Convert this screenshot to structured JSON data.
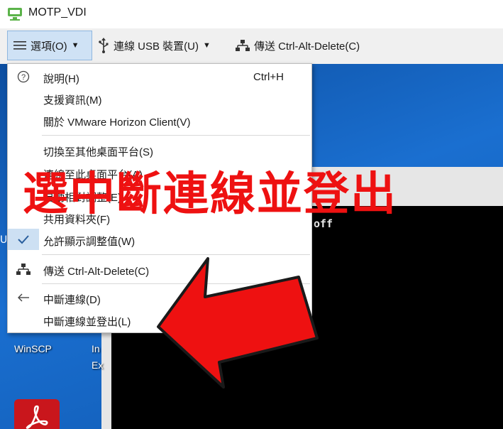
{
  "window": {
    "title": "MOTP_VDI",
    "app_icon": "vmware-horizon-icon"
  },
  "toolbar": {
    "options_label": "選項(O)",
    "usb_label": "連線 USB 裝置(U)",
    "send_cad_label": "傳送 Ctrl-Alt-Delete(C)"
  },
  "menu": {
    "items": [
      {
        "label": "說明(H)",
        "shortcut": "Ctrl+H",
        "icon": "help-icon"
      },
      {
        "label": "支援資訊(M)"
      },
      {
        "label": "關於 VMware Horizon Client(V)"
      },
      {
        "label": "切換至其他桌面平台(S)"
      },
      {
        "label": "連線至此桌面平台(A)"
      },
      {
        "label": "自動相對調整(E)"
      },
      {
        "label": "共用資料夾(F)"
      },
      {
        "label": "允許顯示調整值(W)",
        "checked": true,
        "icon": "check-icon"
      },
      {
        "label": "傳送 Ctrl-Alt-Delete(C)",
        "icon": "network-icon"
      },
      {
        "label": "中斷連線(D)",
        "icon": "back-arrow-icon"
      },
      {
        "label": "中斷連線並登出(L)"
      }
    ]
  },
  "desktop": {
    "icons": [
      {
        "label": "WinSCP"
      },
      {
        "label": "In"
      },
      {
        "label": "Ex"
      }
    ],
    "left_strip_text": "U",
    "console_text": "off"
  },
  "annotation": {
    "text": "選中斷連線並登出",
    "color": "#ee1111"
  },
  "colors": {
    "accent": "#cfe2f5",
    "desktop": "#1763b8",
    "annotation": "#ee1111"
  }
}
